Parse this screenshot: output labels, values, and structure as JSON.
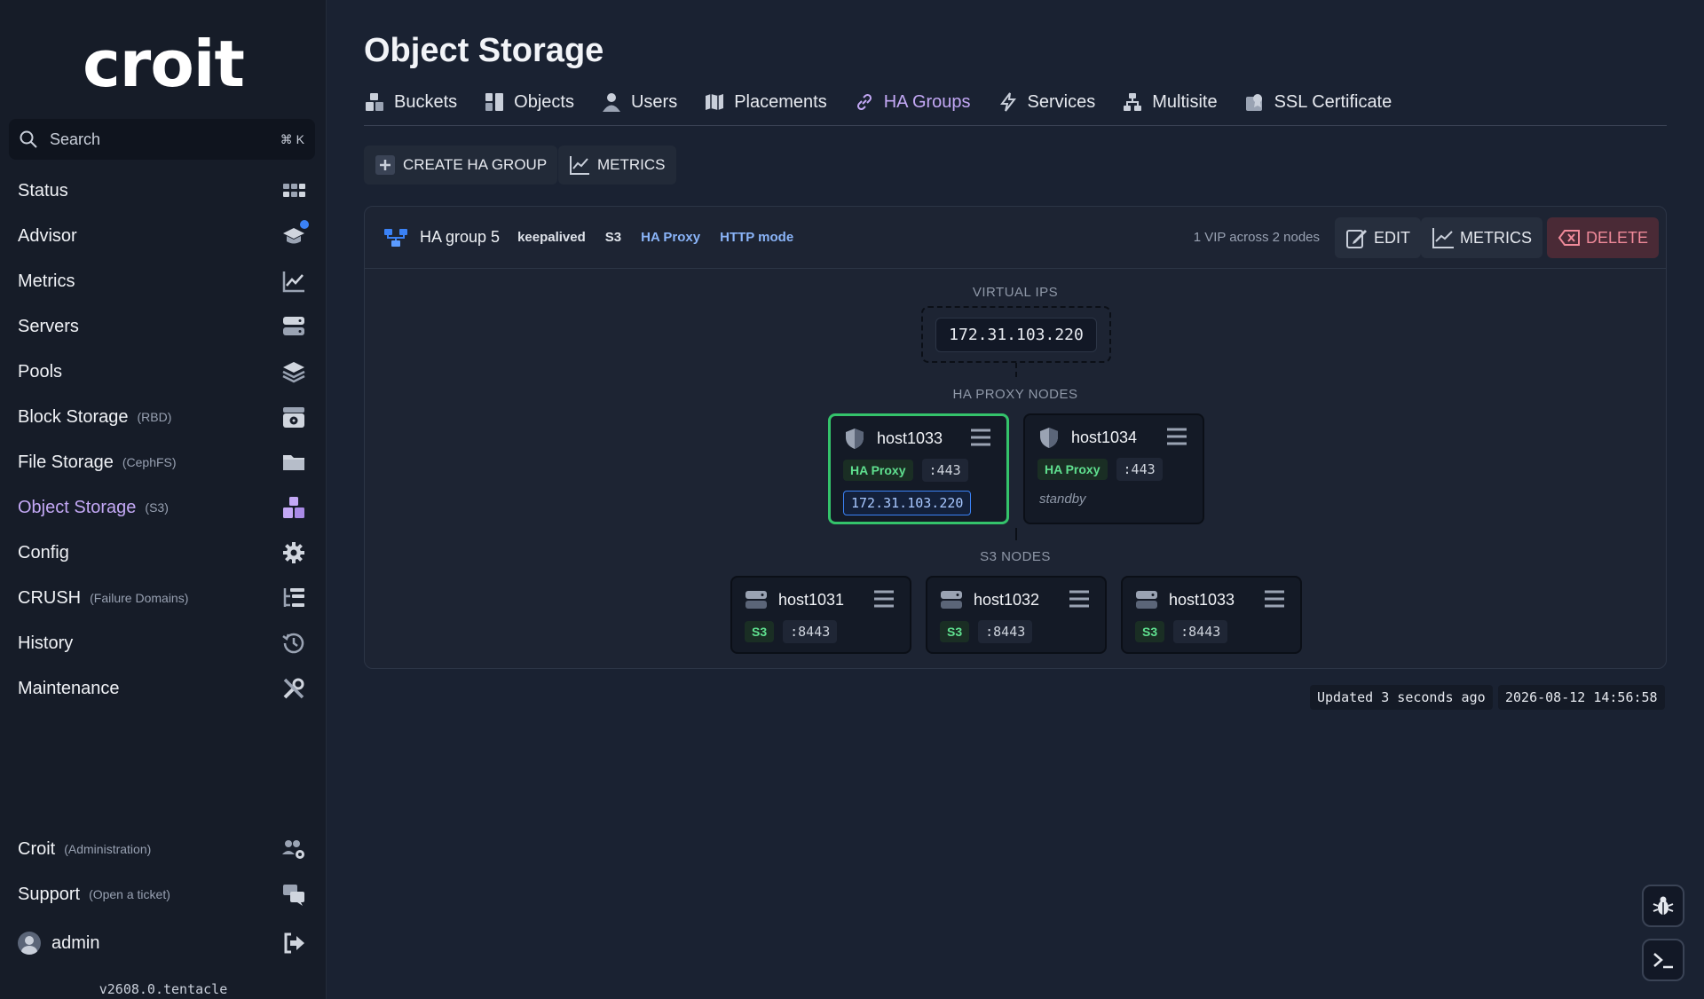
{
  "app": {
    "logo": "croit",
    "version": "v2608.0.tentacle"
  },
  "search": {
    "placeholder": "Search",
    "shortcut": "⌘ K"
  },
  "sidebar": {
    "items": [
      {
        "label": "Status",
        "sub": ""
      },
      {
        "label": "Advisor",
        "sub": ""
      },
      {
        "label": "Metrics",
        "sub": ""
      },
      {
        "label": "Servers",
        "sub": ""
      },
      {
        "label": "Pools",
        "sub": ""
      },
      {
        "label": "Block Storage",
        "sub": "(RBD)"
      },
      {
        "label": "File Storage",
        "sub": "(CephFS)"
      },
      {
        "label": "Object Storage",
        "sub": "(S3)"
      },
      {
        "label": "Config",
        "sub": ""
      },
      {
        "label": "CRUSH",
        "sub": "(Failure Domains)"
      },
      {
        "label": "History",
        "sub": ""
      },
      {
        "label": "Maintenance",
        "sub": ""
      }
    ],
    "bottom": [
      {
        "label": "Croit",
        "sub": "(Administration)"
      },
      {
        "label": "Support",
        "sub": "(Open a ticket)"
      }
    ],
    "user": "admin"
  },
  "page": {
    "title": "Object Storage",
    "tabs": [
      "Buckets",
      "Objects",
      "Users",
      "Placements",
      "HA Groups",
      "Services",
      "Multisite",
      "SSL Certificate"
    ],
    "active_tab": "HA Groups"
  },
  "toolbar": {
    "create_label": "CREATE HA GROUP",
    "metrics_label": "METRICS"
  },
  "group": {
    "name": "HA group 5",
    "tags": [
      "keepalived",
      "S3",
      "HA Proxy",
      "HTTP mode"
    ],
    "summary": "1 VIP across 2 nodes",
    "edit_label": "EDIT",
    "metrics_label": "METRICS",
    "delete_label": "DELETE",
    "virtual_ips_label": "VIRTUAL IPS",
    "virtual_ip": "172.31.103.220",
    "haproxy_label": "HA PROXY NODES",
    "haproxy_nodes": [
      {
        "host": "host1033",
        "role": "HA Proxy",
        "port": ":443",
        "vip": "172.31.103.220",
        "state": ""
      },
      {
        "host": "host1034",
        "role": "HA Proxy",
        "port": ":443",
        "vip": "",
        "state": "standby"
      }
    ],
    "s3_label": "S3 NODES",
    "s3_nodes": [
      {
        "host": "host1031",
        "role": "S3",
        "port": ":8443"
      },
      {
        "host": "host1032",
        "role": "S3",
        "port": ":8443"
      },
      {
        "host": "host1033",
        "role": "S3",
        "port": ":8443"
      }
    ]
  },
  "status": {
    "updated": "Updated 3 seconds ago",
    "timestamp": "2026-08-12 14:56:58"
  },
  "colors": {
    "accent": "#c3a8f5",
    "active_border": "#34c36b",
    "delete": "#f08a9a",
    "badge_blue": "#8ab4f8"
  }
}
